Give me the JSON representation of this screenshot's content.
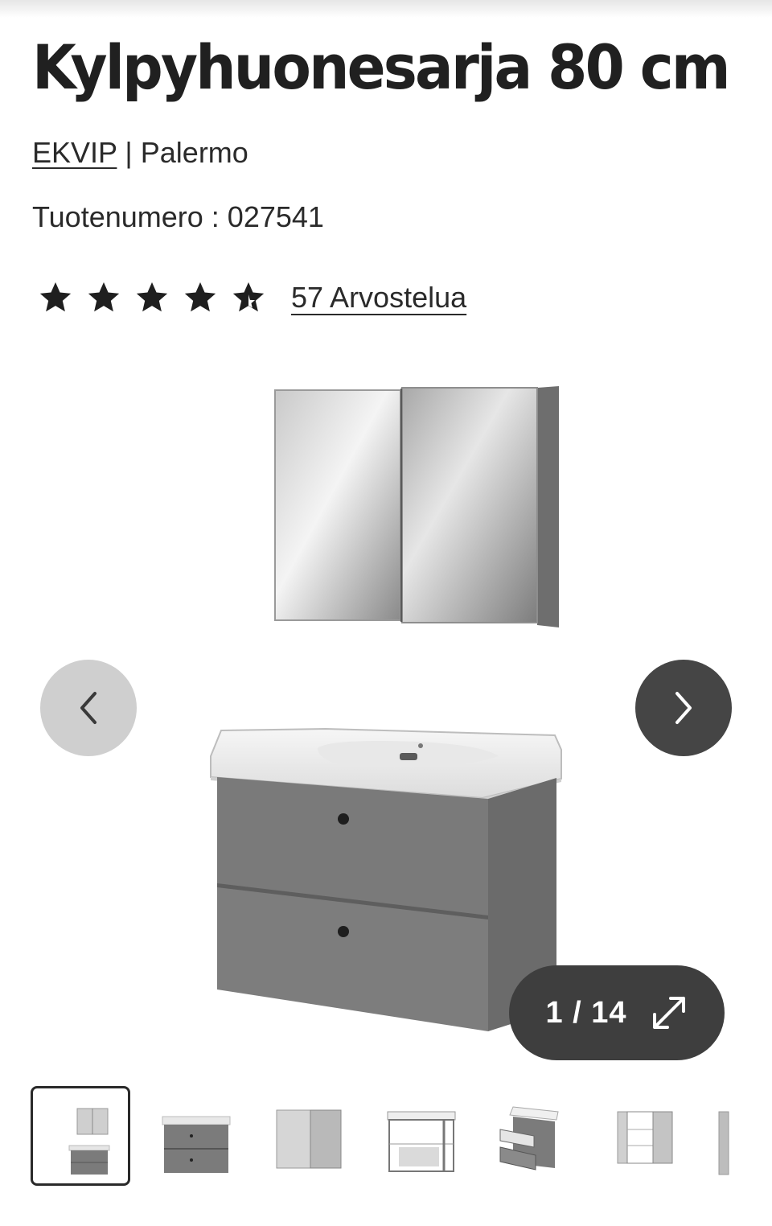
{
  "product": {
    "title": "Kylpyhuonesarja 80 cm",
    "brand": "EKVIP",
    "separator": " | ",
    "series": "Palermo",
    "sku_label": "Tuotenumero : ",
    "sku": "027541"
  },
  "rating": {
    "stars": 4.5,
    "max_stars": 5,
    "reviews_label": "57 Arvostelua"
  },
  "gallery": {
    "counter": "1 / 14",
    "current": 1,
    "total": 14
  },
  "thumbnails": [
    {
      "subject": "full-set",
      "active": true
    },
    {
      "subject": "vanity-cabinet",
      "active": false
    },
    {
      "subject": "mirror-cabinet",
      "active": false
    },
    {
      "subject": "cabinet-inside",
      "active": false
    },
    {
      "subject": "drawers-open",
      "active": false
    },
    {
      "subject": "mirror-cabinet-open",
      "active": false
    },
    {
      "subject": "partial-next",
      "active": false
    }
  ],
  "icons": {
    "star": "star-icon",
    "prev": "chevron-left-icon",
    "next": "chevron-right-icon",
    "expand": "expand-arrows-icon"
  },
  "colors": {
    "text": "#202020",
    "nav_prev_bg": "#cfcfcf",
    "nav_next_bg": "#454545",
    "counter_bg": "#3e3e3e",
    "cabinet_grey": "#7a7a7a"
  }
}
